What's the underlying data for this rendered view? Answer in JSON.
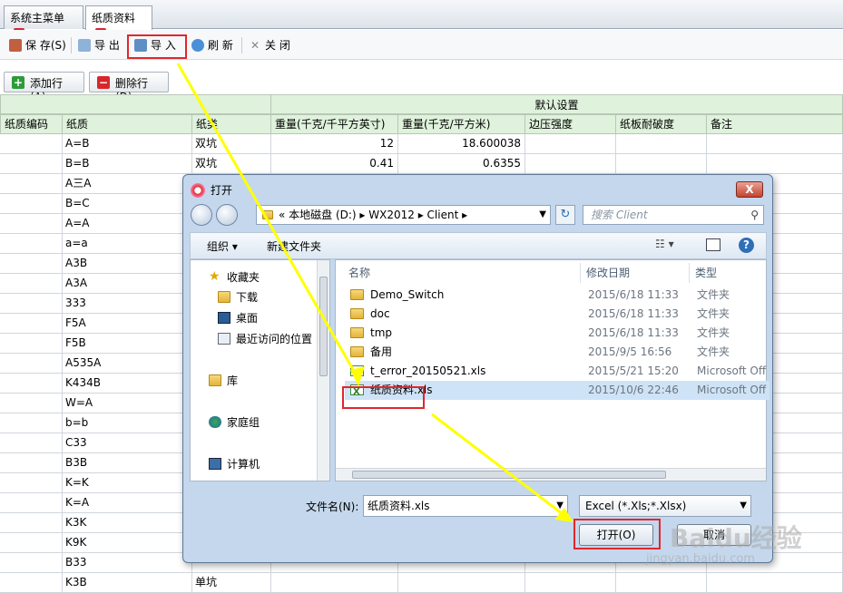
{
  "tabs": [
    {
      "label": "系统主菜单"
    },
    {
      "label": "纸质资料"
    }
  ],
  "toolbar": {
    "save": "保 存(S)",
    "export": "导 出",
    "import": "导 入",
    "refresh": "刷 新",
    "close": "关 闭"
  },
  "row_buttons": {
    "add": "添加行(A)",
    "delete": "删除行(D)"
  },
  "grid": {
    "group_header": "默认设置",
    "columns": [
      "纸质编码",
      "纸质",
      "纸类",
      "重量(千克/千平方英寸)",
      "重量(千克/平方米)",
      "边压强度",
      "纸板耐破度",
      "备注"
    ],
    "rows": [
      {
        "code": "",
        "paper": "A=B",
        "type": "双坑",
        "w1": "12",
        "w2": "18.600038"
      },
      {
        "code": "",
        "paper": "B=B",
        "type": "双坑",
        "w1": "0.41",
        "w2": "0.6355"
      },
      {
        "code": "",
        "paper": "A三A",
        "type": "",
        "w1": "",
        "w2": ""
      },
      {
        "code": "",
        "paper": "B=C",
        "type": "",
        "w1": "",
        "w2": ""
      },
      {
        "code": "",
        "paper": "A=A",
        "type": "",
        "w1": "",
        "w2": ""
      },
      {
        "code": "",
        "paper": "a=a",
        "type": "",
        "w1": "",
        "w2": ""
      },
      {
        "code": "",
        "paper": "A3B",
        "type": "",
        "w1": "",
        "w2": ""
      },
      {
        "code": "",
        "paper": "A3A",
        "type": "",
        "w1": "",
        "w2": ""
      },
      {
        "code": "",
        "paper": "333",
        "type": "",
        "w1": "",
        "w2": ""
      },
      {
        "code": "",
        "paper": "F5A",
        "type": "",
        "w1": "",
        "w2": ""
      },
      {
        "code": "",
        "paper": "F5B",
        "type": "",
        "w1": "",
        "w2": ""
      },
      {
        "code": "",
        "paper": "A535A",
        "type": "",
        "w1": "",
        "w2": ""
      },
      {
        "code": "",
        "paper": "K434B",
        "type": "",
        "w1": "",
        "w2": ""
      },
      {
        "code": "",
        "paper": "W=A",
        "type": "",
        "w1": "",
        "w2": ""
      },
      {
        "code": "",
        "paper": "b=b",
        "type": "",
        "w1": "",
        "w2": ""
      },
      {
        "code": "",
        "paper": "C33",
        "type": "",
        "w1": "",
        "w2": ""
      },
      {
        "code": "",
        "paper": "B3B",
        "type": "",
        "w1": "",
        "w2": ""
      },
      {
        "code": "",
        "paper": "K=K",
        "type": "",
        "w1": "",
        "w2": ""
      },
      {
        "code": "",
        "paper": "K=A",
        "type": "",
        "w1": "",
        "w2": ""
      },
      {
        "code": "",
        "paper": "K3K",
        "type": "",
        "w1": "",
        "w2": ""
      },
      {
        "code": "",
        "paper": "K9K",
        "type": "",
        "w1": "",
        "w2": ""
      },
      {
        "code": "",
        "paper": "B33",
        "type": "",
        "w1": "",
        "w2": ""
      },
      {
        "code": "",
        "paper": "K3B",
        "type": "单坑",
        "w1": "",
        "w2": ""
      }
    ]
  },
  "dialog": {
    "title": "打开",
    "close_label": "X",
    "address": "« 本地磁盘 (D:) ▸ WX2012 ▸ Client ▸",
    "search_placeholder": "搜索 Client",
    "organize": "组织 ▾",
    "new_folder": "新建文件夹",
    "nav": {
      "favorites": "收藏夹",
      "downloads": "下载",
      "desktop": "桌面",
      "recent": "最近访问的位置",
      "libraries": "库",
      "homegroup": "家庭组",
      "computer": "计算机"
    },
    "columns": {
      "name": "名称",
      "date": "修改日期",
      "type": "类型"
    },
    "files": [
      {
        "name": "Demo_Switch",
        "date": "2015/6/18 11:33",
        "type": "文件夹",
        "kind": "folder"
      },
      {
        "name": "doc",
        "date": "2015/6/18 11:33",
        "type": "文件夹",
        "kind": "folder"
      },
      {
        "name": "tmp",
        "date": "2015/6/18 11:33",
        "type": "文件夹",
        "kind": "folder"
      },
      {
        "name": "备用",
        "date": "2015/9/5 16:56",
        "type": "文件夹",
        "kind": "folder"
      },
      {
        "name": "t_error_20150521.xls",
        "date": "2015/5/21 15:20",
        "type": "Microsoft Off",
        "kind": "xls"
      },
      {
        "name": "纸质资料.xls",
        "date": "2015/10/6 22:46",
        "type": "Microsoft Off",
        "kind": "xls"
      }
    ],
    "filename_label": "文件名(N):",
    "filename_value": "纸质资料.xls",
    "filter": "Excel (*.Xls;*.Xlsx)",
    "open": "打开(O)",
    "cancel": "取消"
  },
  "watermark": {
    "brand": "Baidu经验",
    "url": "jingyan.baidu.com"
  },
  "colors": {
    "highlight_box": "#e0272d",
    "arrow": "#ffff00",
    "grid_header": "#dff2dc"
  }
}
